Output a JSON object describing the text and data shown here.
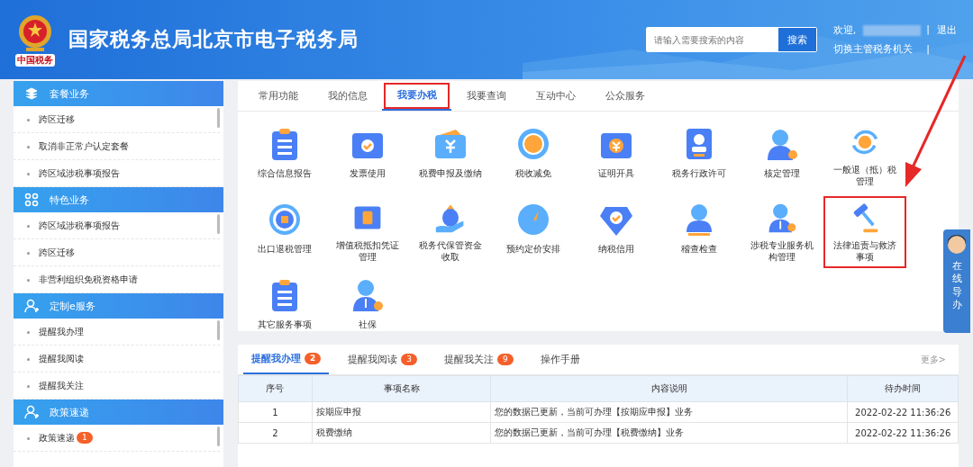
{
  "header": {
    "logo_caption": "中国税务",
    "title": "国家税务总局北京市电子税务局",
    "search": {
      "placeholder": "请输入需要搜索的内容",
      "button": "搜索"
    },
    "welcome": "欢迎,",
    "separator_1": "|",
    "logout": "退出",
    "switch": "切换主管税务机关",
    "separator_2": "|"
  },
  "sidebar": [
    {
      "title": "套餐业务",
      "items": [
        {
          "label": "跨区迁移"
        },
        {
          "label": "取消非正常户认定套餐"
        },
        {
          "label": "跨区域涉税事项报告"
        }
      ]
    },
    {
      "title": "特色业务",
      "items": [
        {
          "label": "跨区域涉税事项报告"
        },
        {
          "label": "跨区迁移"
        },
        {
          "label": "非营利组织免税资格申请"
        }
      ]
    },
    {
      "title": "定制e服务",
      "items": [
        {
          "label": "提醒我办理"
        },
        {
          "label": "提醒我阅读"
        },
        {
          "label": "提醒我关注"
        }
      ]
    },
    {
      "title": "政策速递",
      "items": [
        {
          "label": "政策速递",
          "badge": "1"
        }
      ]
    }
  ],
  "tabs": [
    {
      "label": "常用功能",
      "selected": false,
      "annotated": false
    },
    {
      "label": "我的信息",
      "selected": false,
      "annotated": false
    },
    {
      "label": "我要办税",
      "selected": true,
      "annotated": true
    },
    {
      "label": "我要查询",
      "selected": false,
      "annotated": false
    },
    {
      "label": "互动中心",
      "selected": false,
      "annotated": false
    },
    {
      "label": "公众服务",
      "selected": false,
      "annotated": false
    }
  ],
  "services": [
    {
      "label": "综合信息报告",
      "annotated": false
    },
    {
      "label": "发票使用",
      "annotated": false
    },
    {
      "label": "税费申报及缴纳",
      "annotated": false
    },
    {
      "label": "税收减免",
      "annotated": false
    },
    {
      "label": "证明开具",
      "annotated": false
    },
    {
      "label": "税务行政许可",
      "annotated": false
    },
    {
      "label": "核定管理",
      "annotated": false
    },
    {
      "label": "一般退（抵）税管理",
      "annotated": false
    },
    {
      "label": "出口退税管理",
      "annotated": false
    },
    {
      "label": "增值税抵扣凭证管理",
      "annotated": false
    },
    {
      "label": "税务代保管资金收取",
      "annotated": false
    },
    {
      "label": "预约定价安排",
      "annotated": false
    },
    {
      "label": "纳税信用",
      "annotated": false
    },
    {
      "label": "稽查检查",
      "annotated": false
    },
    {
      "label": "涉税专业服务机构管理",
      "annotated": false
    },
    {
      "label": "法律追责与救济事项",
      "annotated": true
    },
    {
      "label": "其它服务事项",
      "annotated": false
    },
    {
      "label": "社保",
      "annotated": false
    }
  ],
  "reminders": {
    "tabs": [
      {
        "label": "提醒我办理",
        "badge": "2",
        "selected": true
      },
      {
        "label": "提醒我阅读",
        "badge": "3",
        "selected": false
      },
      {
        "label": "提醒我关注",
        "badge": "9",
        "selected": false
      },
      {
        "label": "操作手册",
        "selected": false
      }
    ],
    "more": "更多>",
    "columns": [
      "序号",
      "事项名称",
      "内容说明",
      "待办时间"
    ],
    "rows": [
      [
        "1",
        "按期应申报",
        "您的数据已更新，当前可办理【按期应申报】业务",
        "2022-02-22 11:36:26"
      ],
      [
        "2",
        "税费缴纳",
        "您的数据已更新，当前可办理【税费缴纳】业务",
        "2022-02-22 11:36:26"
      ]
    ]
  },
  "guide": {
    "label": "在线导办"
  }
}
